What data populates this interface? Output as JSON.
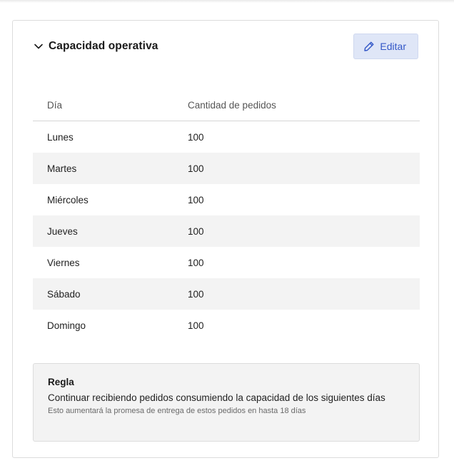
{
  "section": {
    "title": "Capacidad operativa",
    "edit_label": "Editar"
  },
  "table": {
    "headers": [
      "Día",
      "Cantidad de pedidos"
    ],
    "rows": [
      {
        "day": "Lunes",
        "orders": "100"
      },
      {
        "day": "Martes",
        "orders": "100"
      },
      {
        "day": "Miércoles",
        "orders": "100"
      },
      {
        "day": "Jueves",
        "orders": "100"
      },
      {
        "day": "Viernes",
        "orders": "100"
      },
      {
        "day": "Sábado",
        "orders": "100"
      },
      {
        "day": "Domingo",
        "orders": "100"
      }
    ]
  },
  "rule": {
    "title": "Regla",
    "description": "Continuar recibiendo pedidos consumiendo la capacidad de los siguientes días",
    "note": "Esto aumentará la promesa de entrega de estos pedidos en hasta 18 días"
  },
  "colors": {
    "accent": "#3357c7",
    "button_bg": "#dfe6f7",
    "stripe": "#f3f3f3"
  },
  "icons": {
    "collapse": "chevron-down-icon",
    "edit": "pencil-icon"
  }
}
